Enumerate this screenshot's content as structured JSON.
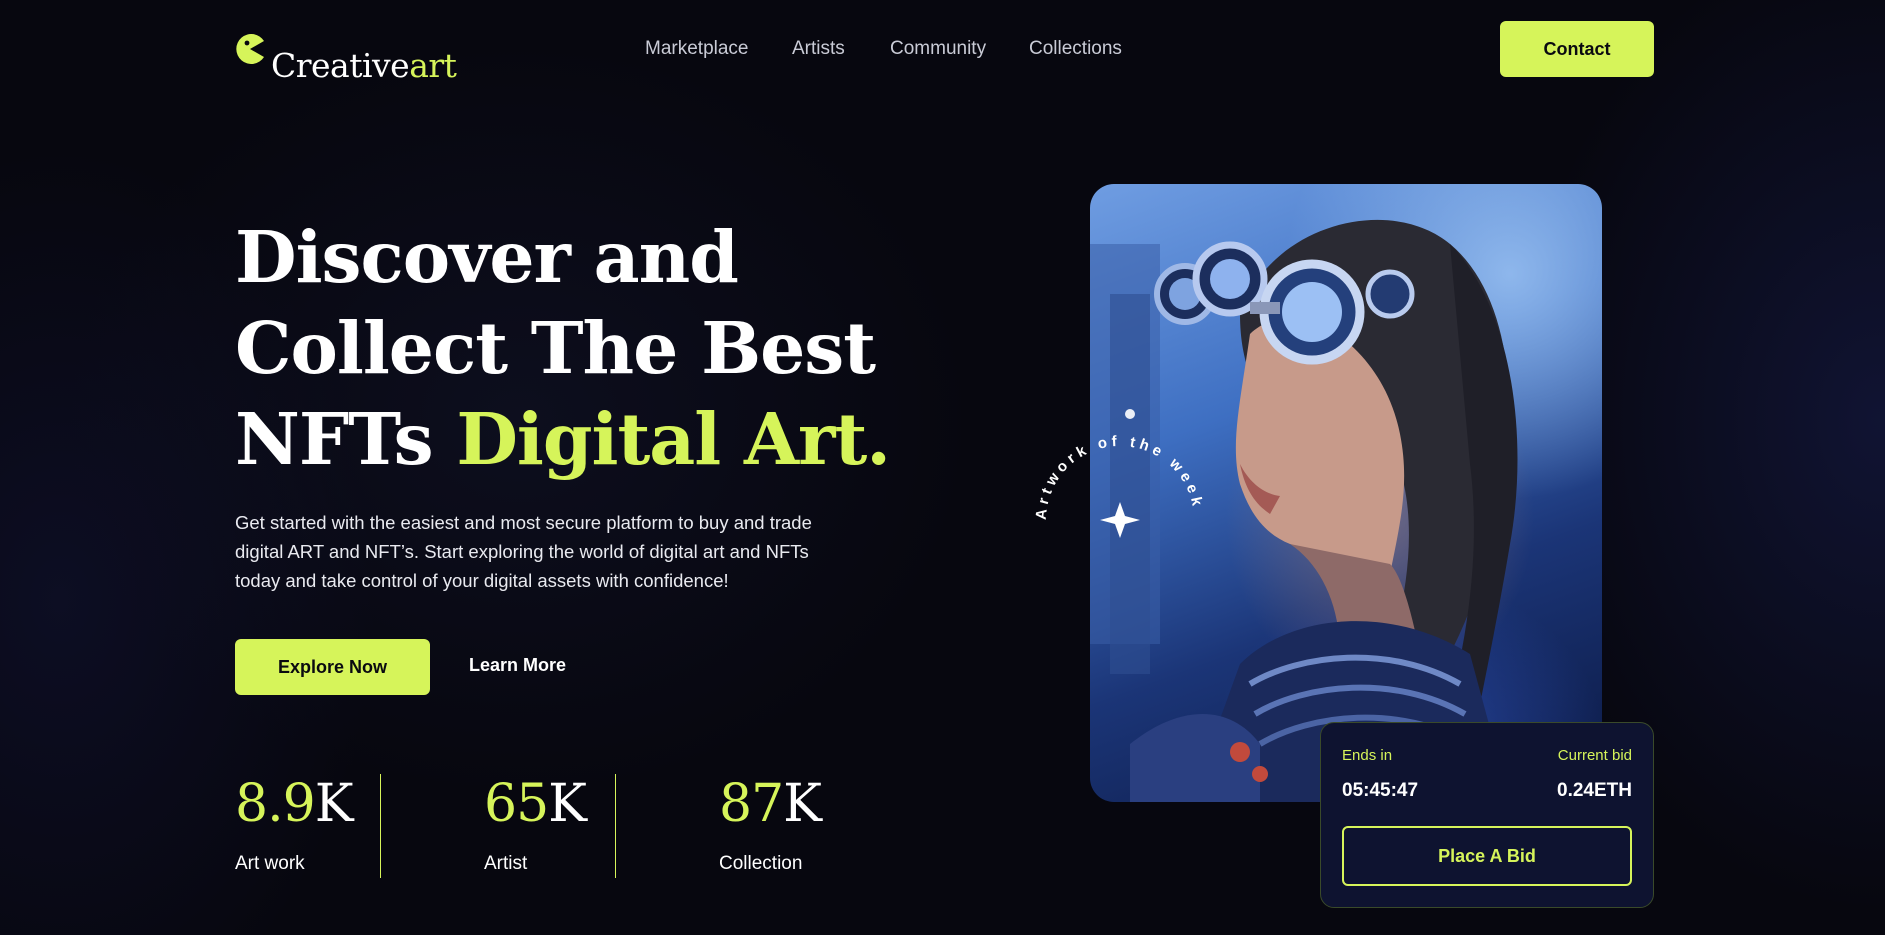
{
  "brand": {
    "name_part1": "Creative",
    "name_part2": "art",
    "accent_color": "#d6f45a",
    "icon": "pacman-icon"
  },
  "nav": {
    "items": [
      {
        "label": "Marketplace"
      },
      {
        "label": "Artists"
      },
      {
        "label": "Community"
      },
      {
        "label": "Collections"
      }
    ],
    "contact_label": "Contact"
  },
  "hero": {
    "title_line1": "Discover and",
    "title_line2": "Collect The Best",
    "title_line3_plain": "NFTs ",
    "title_line3_accent": "Digital Art.",
    "description": "Get started with the easiest and most secure platform to buy and trade digital ART and NFT’s. Start exploring the world of digital art and NFTs today and take control of your digital assets with confidence!",
    "primary_cta": "Explore Now",
    "secondary_cta": "Learn More"
  },
  "stats": [
    {
      "number": "8.9",
      "unit": "K",
      "label": "Art work"
    },
    {
      "number": "65",
      "unit": "K",
      "label": "Artist"
    },
    {
      "number": "87",
      "unit": "K",
      "label": "Collection"
    }
  ],
  "artwork": {
    "badge_text": "Artwork of the week",
    "badge_icon": "sparkle-star-icon"
  },
  "bid": {
    "ends_label": "Ends in",
    "ends_value": "05:45:47",
    "bid_label": "Current bid",
    "bid_value": "0.24ETH",
    "button_label": "Place A Bid"
  }
}
